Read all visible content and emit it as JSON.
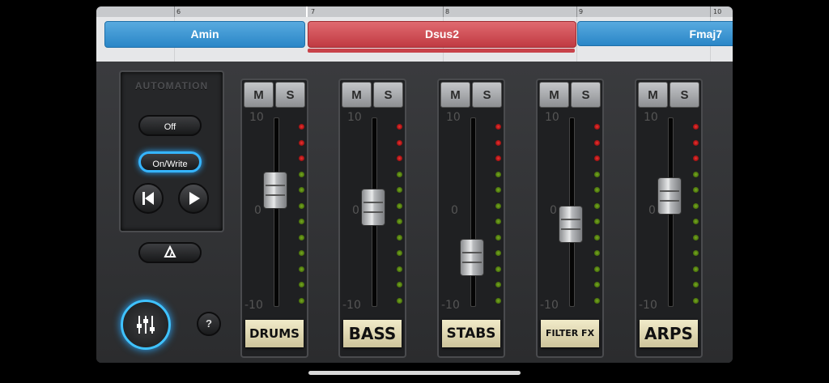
{
  "timeline": {
    "bars": [
      "6",
      "7",
      "8",
      "9",
      "10"
    ],
    "chords": [
      "Amin",
      "Dsus2",
      "Fmaj7"
    ]
  },
  "automation": {
    "title": "AUTOMATION",
    "off_label": "Off",
    "on_write_label": "On/Write",
    "selected_mode": "On/Write"
  },
  "help_label": "?",
  "scale": {
    "top": "10",
    "mid": "0",
    "bottom": "-10"
  },
  "mute_label": "M",
  "solo_label": "S",
  "channels": [
    {
      "name": "DRUMS",
      "fader_level": 0.63
    },
    {
      "name": "BASS",
      "fader_level": 0.54
    },
    {
      "name": "STABS",
      "fader_level": 0.27
    },
    {
      "name": "FILTER FX",
      "fader_level": 0.45
    },
    {
      "name": "ARPS",
      "fader_level": 0.6
    }
  ],
  "colors": {
    "accent": "#35b5ff",
    "chord_blue": "#2a86c7",
    "chord_red": "#c03a42"
  }
}
